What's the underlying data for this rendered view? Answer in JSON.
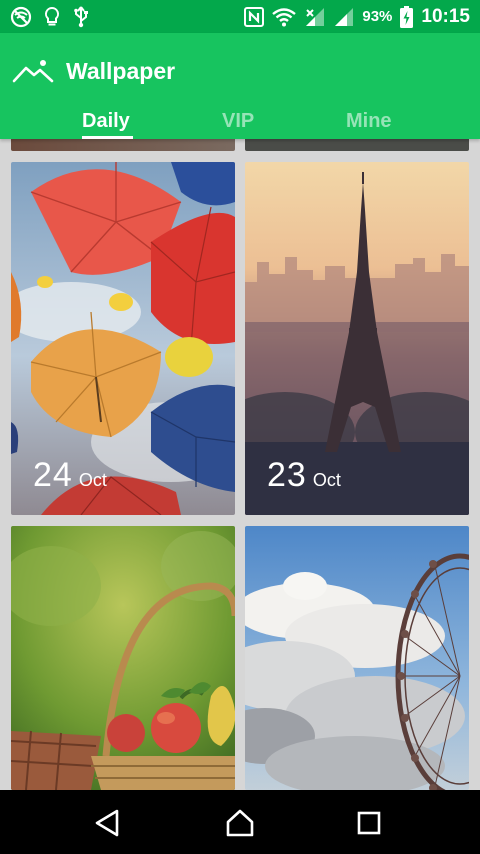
{
  "status_bar": {
    "battery_percent": "93%",
    "time": "10:15",
    "icons": [
      "wifi-off-icon",
      "bulb-icon",
      "usb-icon",
      "nfc-icon",
      "wifi-icon",
      "signal-icon",
      "signal-icon",
      "battery-charging-icon"
    ]
  },
  "app_bar": {
    "title": "Wallpaper",
    "logo_icon": "mountain-logo-icon",
    "tabs": [
      {
        "label": "Daily",
        "active": true
      },
      {
        "label": "VIP",
        "active": false
      },
      {
        "label": "Mine",
        "active": false
      }
    ]
  },
  "wallpapers": [
    {
      "id": "umbrellas",
      "day": "24",
      "month": "Oct"
    },
    {
      "id": "eiffel-tower",
      "day": "23",
      "month": "Oct"
    },
    {
      "id": "fruit-basket",
      "day": "",
      "month": ""
    },
    {
      "id": "ferris-wheel",
      "day": "",
      "month": ""
    }
  ],
  "nav_bar": {
    "icons": [
      "back-icon",
      "home-icon",
      "recents-icon"
    ]
  },
  "colors": {
    "status_bar": "#03a84b",
    "app_bar": "#17c45f",
    "background": "#d6d6d6"
  }
}
